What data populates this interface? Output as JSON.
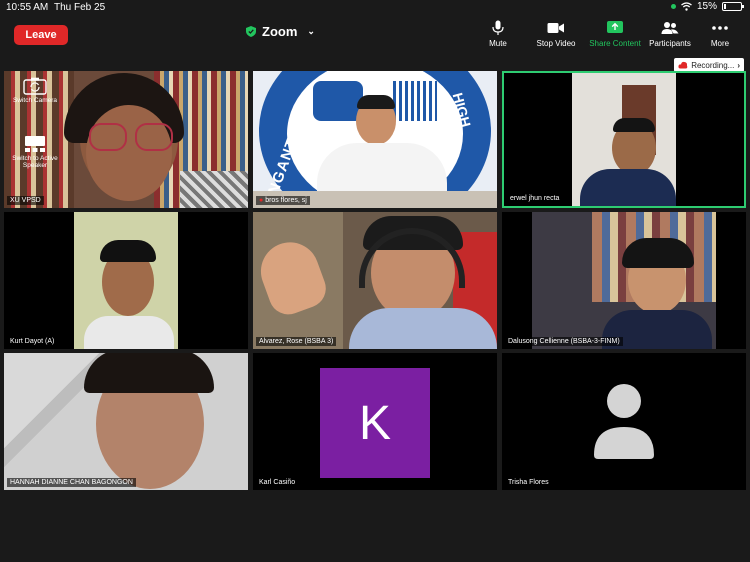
{
  "status_bar": {
    "time": "10:55 AM",
    "date": "Thu Feb 25",
    "battery": "15%",
    "battery_level": 0.15
  },
  "toolbar": {
    "leave_label": "Leave",
    "meeting_title": "Zoom",
    "tools": [
      {
        "label": "Mute",
        "icon": "microphone-icon"
      },
      {
        "label": "Stop Video",
        "icon": "video-camera-icon"
      },
      {
        "label": "Share Content",
        "icon": "share-screen-icon",
        "color": "#22c55e"
      },
      {
        "label": "Participants",
        "icon": "participants-icon"
      },
      {
        "label": "More",
        "icon": "more-dots-icon"
      }
    ]
  },
  "recording_label": "Recording...",
  "side_controls": {
    "switch_camera": "Switch Camera",
    "switch_speaker": "Switch to Active Speaker"
  },
  "participants": [
    {
      "name": "XU VPSD"
    },
    {
      "name": "bros flores, sj"
    },
    {
      "name": "erwel jhun recta",
      "active": true
    },
    {
      "name": "Kurt Dayot (A)"
    },
    {
      "name": "Alvarez, Rose (BSBA 3)"
    },
    {
      "name": "Dalusong Cellienne (BSBA-3-FINM)"
    },
    {
      "name": "HANNAH DIANNE CHAN BAGONGON"
    },
    {
      "name": "Karl Casiño",
      "initial": "K",
      "avatar_color": "#7b1fa2"
    },
    {
      "name": "Trisha Flores"
    }
  ],
  "background_text": {
    "school_banner": "NGANTUCA",
    "school_banner_2": "HIGH SCHOO"
  },
  "colors": {
    "leave": "#e02828",
    "active_border": "#2ecc71",
    "accent_green": "#22c55e"
  }
}
